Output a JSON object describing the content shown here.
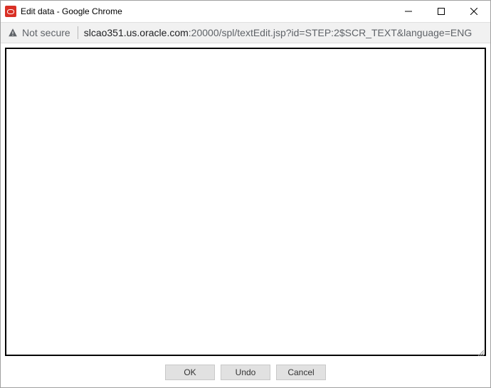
{
  "window": {
    "title": "Edit data - Google Chrome"
  },
  "address": {
    "security_label": "Not secure",
    "host": "slcao351.us.oracle.com",
    "rest": ":20000/spl/textEdit.jsp?id=STEP:2$SCR_TEXT&language=ENG"
  },
  "editor": {
    "value": ""
  },
  "buttons": {
    "ok": "OK",
    "undo": "Undo",
    "cancel": "Cancel"
  }
}
